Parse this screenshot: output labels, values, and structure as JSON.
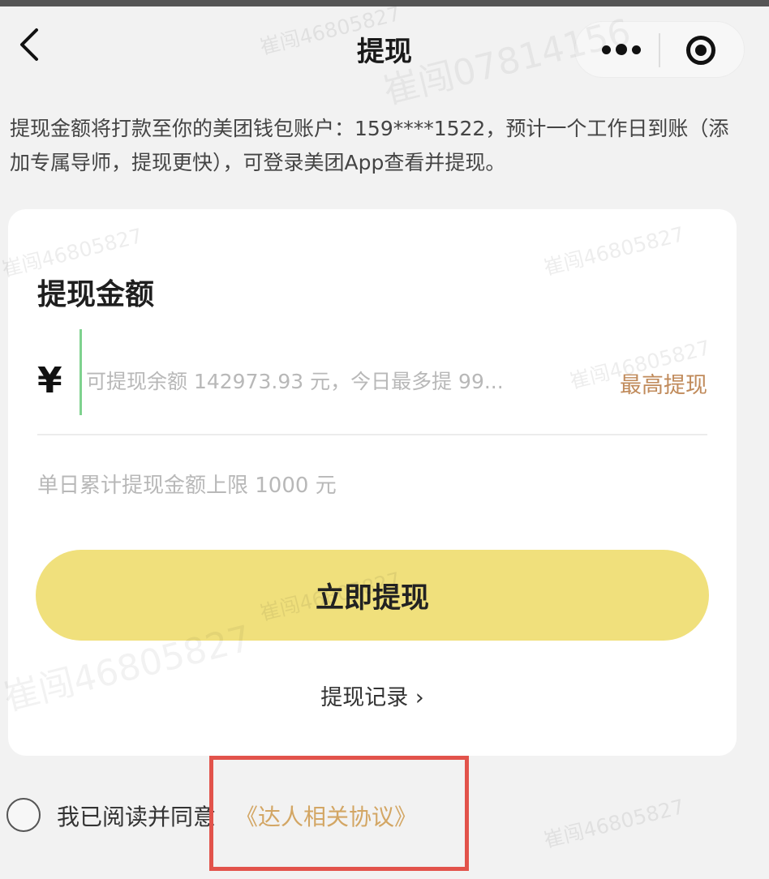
{
  "nav": {
    "title": "提现",
    "back_icon": "chevron-left-icon",
    "more_icon": "more-dots-icon",
    "close_icon": "target-close-icon"
  },
  "notice": "提现金额将打款至你的美团钱包账户：159****1522，预计一个工作日到账（添加专属导师，提现更快），可登录美团App查看并提现。",
  "card": {
    "title": "提现金额",
    "currency": "¥",
    "amount_value": "",
    "amount_placeholder": "可提现余额 142973.93 元，今日最多提 99...",
    "max_label": "最高提现",
    "limit_note": "单日累计提现金额上限 1000 元",
    "withdraw_label": "立即提现",
    "record_label": "提现记录 ›"
  },
  "agreement": {
    "checked": false,
    "text": "我已阅读并同意",
    "link": "《达人相关协议》"
  },
  "watermarks": [
    "崔闯46805827",
    "崔闯07814156",
    "崔闯46805827",
    "崔闯46805827",
    "崔闯46805827",
    "崔闯46805827",
    "崔闯46805827",
    "崔闯46805827"
  ],
  "colors": {
    "button": "#f0e07c",
    "accent": "#c08a5a",
    "link": "#d3a664",
    "highlight": "#e2534b",
    "cursor": "#7fd28f"
  }
}
